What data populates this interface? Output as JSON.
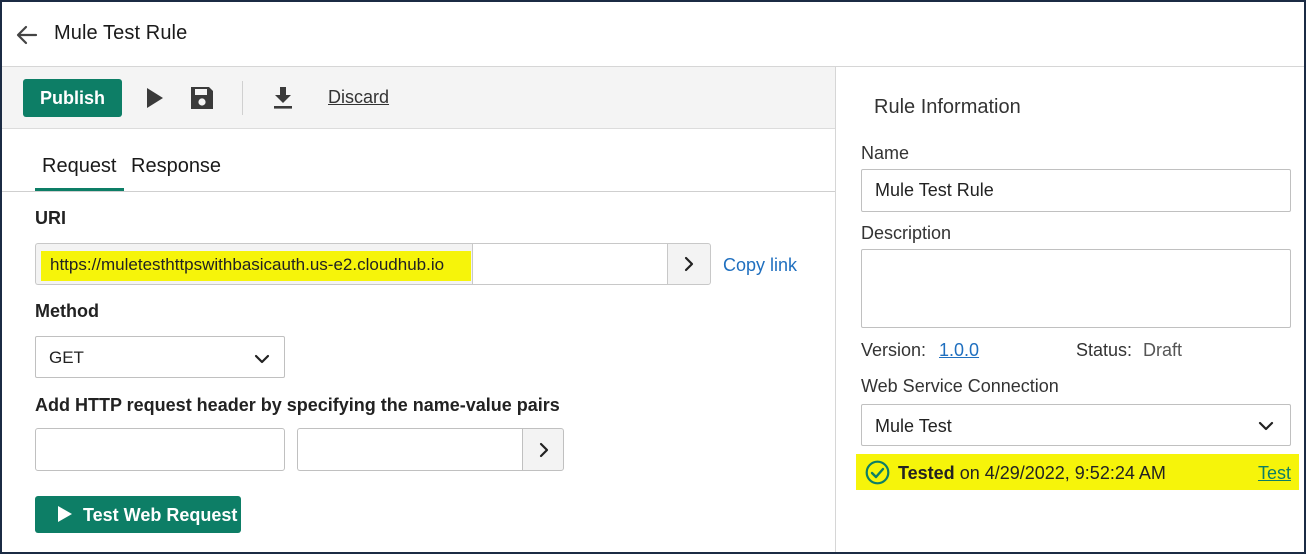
{
  "header": {
    "title": "Mule Test Rule"
  },
  "toolbar": {
    "publish_label": "Publish",
    "discard_label": "Discard"
  },
  "tabs": [
    {
      "label": "Request",
      "active": true
    },
    {
      "label": "Response",
      "active": false
    }
  ],
  "request": {
    "uri_label": "URI",
    "uri_base": "https://muletesthttpswithbasicauth.us-e2.cloudhub.io",
    "uri_path": "",
    "copy_link_label": "Copy link",
    "method_label": "Method",
    "method_value": "GET",
    "headers_label": "Add HTTP request header by specifying the name-value pairs",
    "header_name": "",
    "header_value": "",
    "test_button_label": "Test Web Request"
  },
  "rule_info": {
    "section_title": "Rule Information",
    "name_label": "Name",
    "name_value": "Mule Test Rule",
    "description_label": "Description",
    "description_value": "",
    "version_label": "Version:",
    "version_value": "1.0.0",
    "status_label": "Status:",
    "status_value": "Draft",
    "connection_label": "Web Service Connection",
    "connection_value": "Mule Test",
    "tested_bold": "Tested",
    "tested_rest": " on 4/29/2022, 9:52:24 AM",
    "test_link_label": "Test"
  },
  "colors": {
    "primary": "#0d7e66",
    "link": "#1f6fbf",
    "highlight": "#f6f40a"
  },
  "icons": [
    "back-arrow-icon",
    "play-icon",
    "save-icon",
    "download-icon",
    "chevron-right-icon",
    "chevron-down-icon",
    "check-circle-icon"
  ]
}
